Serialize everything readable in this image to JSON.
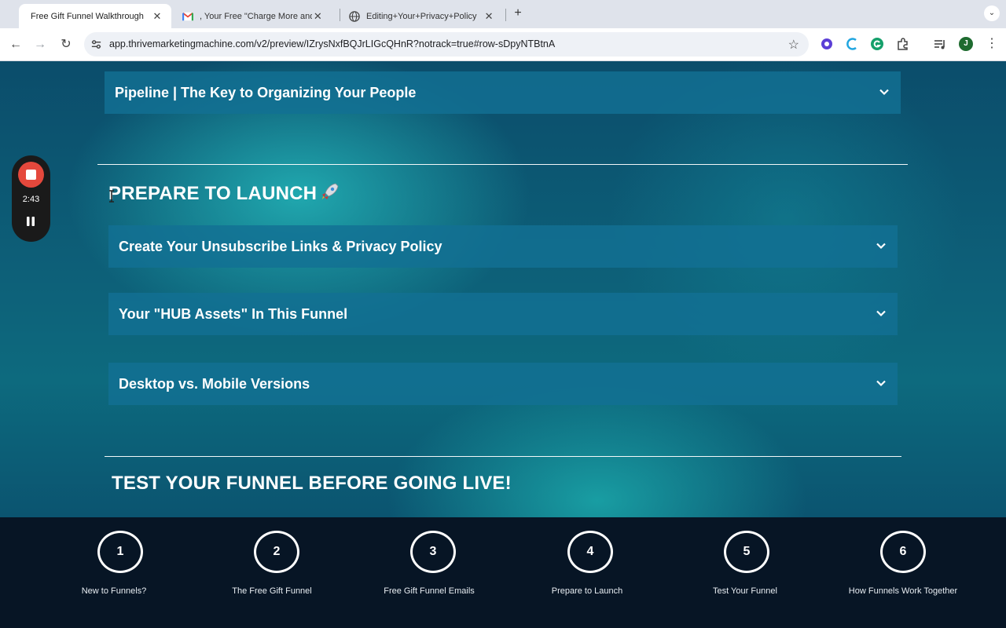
{
  "browser": {
    "tabs": [
      {
        "title": "Free Gift Funnel Walkthrough",
        "active": true,
        "favicon": "none"
      },
      {
        "title": ", Your Free \"Charge More and",
        "active": false,
        "favicon": "gmail-icon"
      },
      {
        "title": "Editing+Your+Privacy+Policy",
        "active": false,
        "favicon": "globe-icon"
      }
    ],
    "url": "app.thrivemarketingmachine.com/v2/preview/IZrysNxfBQJrLIGcQHnR?notrack=true#row-sDpyNTBtnA",
    "profile_initial": "J"
  },
  "recorder": {
    "time": "2:43"
  },
  "content": {
    "accordion_top": "Pipeline | The Key to Organizing Your People",
    "section_launch": "PREPARE TO LAUNCH",
    "launch_items": [
      "Create Your Unsubscribe Links & Privacy Policy",
      "Your \"HUB Assets\" In This Funnel",
      "Desktop vs. Mobile Versions"
    ],
    "section_test": "TEST YOUR FUNNEL BEFORE GOING LIVE!"
  },
  "steps": [
    {
      "number": "1",
      "label": "New to Funnels?"
    },
    {
      "number": "2",
      "label": "The Free Gift Funnel"
    },
    {
      "number": "3",
      "label": "Free Gift Funnel Emails"
    },
    {
      "number": "4",
      "label": "Prepare to Launch"
    },
    {
      "number": "5",
      "label": "Test Your Funnel"
    },
    {
      "number": "6",
      "label": "How Funnels Work Together"
    }
  ],
  "colors": {
    "accordion": "#127094",
    "stepbar": "#071525",
    "record": "#e5483c"
  }
}
